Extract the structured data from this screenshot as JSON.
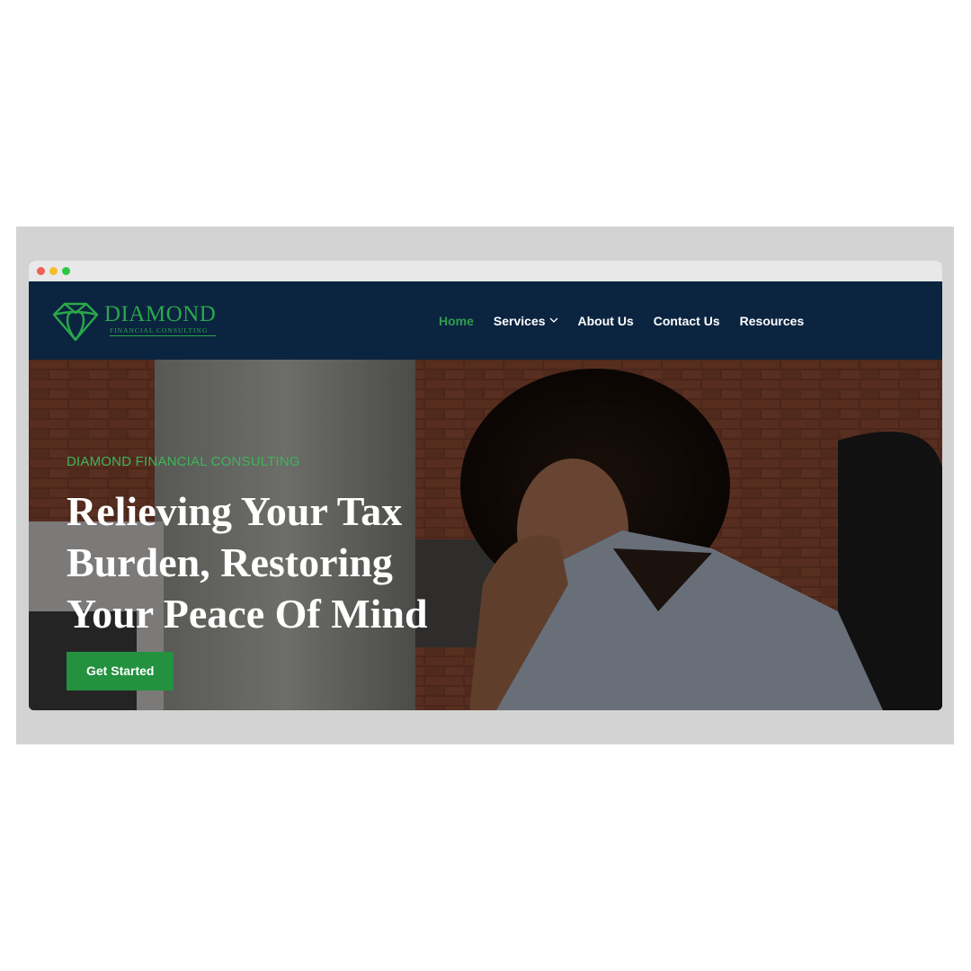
{
  "window": {
    "dots": [
      "#ee5f57",
      "#f5bd2e",
      "#28c840"
    ]
  },
  "brand": {
    "name": "DIAMOND",
    "tagline": "FINANCIAL CONSULTING",
    "color": "#2aa84a"
  },
  "nav": {
    "items": [
      {
        "label": "Home",
        "active": true
      },
      {
        "label": "Services",
        "has_dropdown": true
      },
      {
        "label": "About Us"
      },
      {
        "label": "Contact Us"
      },
      {
        "label": "Resources"
      }
    ]
  },
  "hero": {
    "eyebrow": "DIAMOND FINANCIAL CONSULTING",
    "headline": [
      "Relieving Your Tax",
      "Burden, Restoring",
      "Your Peace Of Mind"
    ],
    "cta_label": "Get Started",
    "cta_color": "#24913f"
  }
}
